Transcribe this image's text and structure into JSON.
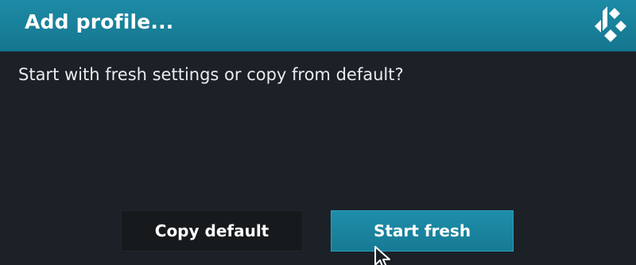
{
  "dialog": {
    "title": "Add profile...",
    "message": "Start with fresh settings or copy from default?",
    "logo_icon": "kodi-logo-icon",
    "buttons": {
      "copy_default": "Copy default",
      "start_fresh": "Start fresh"
    }
  },
  "colors": {
    "titlebar": "#1a829d",
    "background": "#1b2126",
    "focused_button": "#1b86a2",
    "unfocused_button": "#161a1d"
  }
}
